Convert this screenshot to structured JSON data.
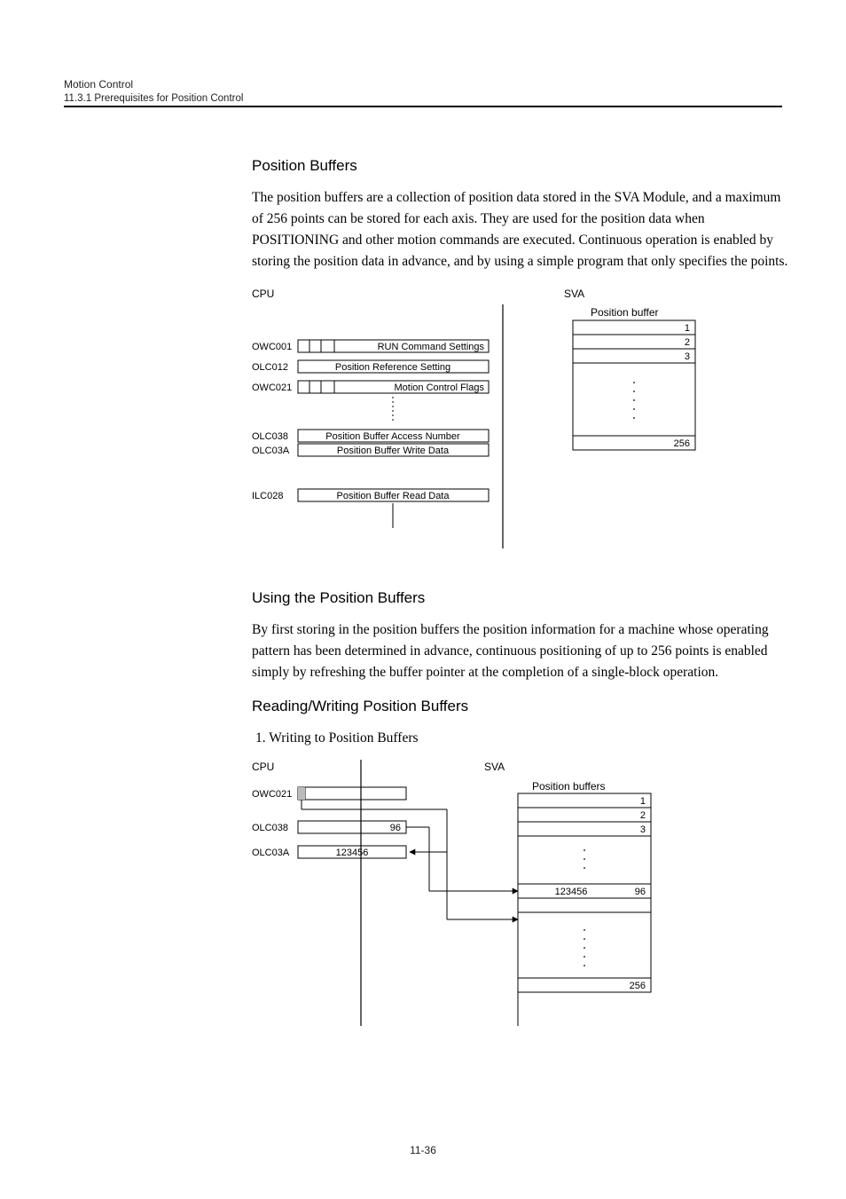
{
  "header": {
    "chapter": "Motion Control",
    "section": "11.3.1  Prerequisites for Position Control"
  },
  "sec1": {
    "title": "Position Buffers",
    "para": "The position buffers are a collection of position data stored in the SVA Module, and a maximum of 256 points can be stored for each axis. They are used for the position data when POSITIONING and other motion commands are executed. Continuous operation is enabled by storing the position data in advance, and by using a simple program that only specifies the points."
  },
  "diag1": {
    "cpu": "CPU",
    "sva": "SVA",
    "pbuf": "Position buffer",
    "r1": "1",
    "r2": "2",
    "r3": "3",
    "r256": "256",
    "owc001": "OWC001",
    "olc012": "OLC012",
    "owc021": "OWC021",
    "olc038": "OLC038",
    "olc03a": "OLC03A",
    "ilc028": "ILC028",
    "runcmd": "RUN Command Settings",
    "posref": "Position Reference Setting",
    "mcflags": "Motion Control Flags",
    "pban": "Position Buffer Access Number",
    "pbwd": "Position Buffer Write Data",
    "pbrd": "Position Buffer Read Data"
  },
  "sec2": {
    "title": "Using the Position Buffers",
    "para": "By first storing in the position buffers the position information for a machine whose operating pattern has been determined in advance, continuous positioning of up to 256 points is enabled simply by refreshing the buffer pointer at the completion of a single-block operation."
  },
  "sec3": {
    "title": "Reading/Writing Position Buffers",
    "item1": "1.  Writing to Position Buffers"
  },
  "diag2": {
    "cpu": "CPU",
    "sva": "SVA",
    "pbuf": "Position buffers",
    "r1": "1",
    "r2": "2",
    "r3": "3",
    "r256": "256",
    "owc021": "OWC021",
    "olc038": "OLC038",
    "olc03a": "OLC03A",
    "v96": "96",
    "v123456": "123456",
    "b96": "96",
    "b123456": "123456"
  },
  "footer": {
    "page": "11-36"
  }
}
